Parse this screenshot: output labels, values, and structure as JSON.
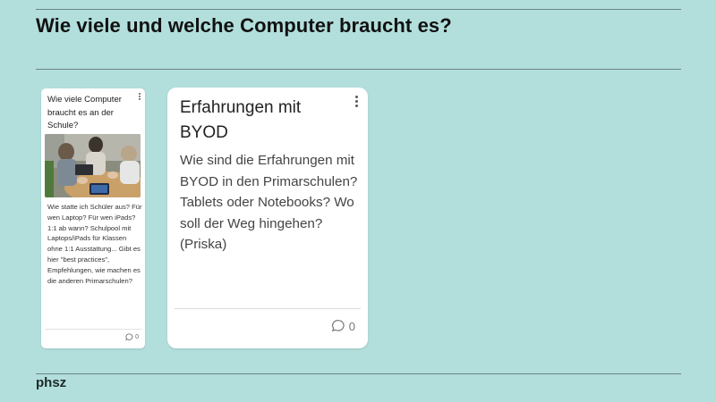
{
  "slide": {
    "title": "Wie viele und welche Computer braucht es?",
    "brand": "phsz"
  },
  "cards": [
    {
      "title": "Wie viele Computer braucht es an der Schule?",
      "body": "Wie statte ich Schüler aus? Für wen Laptop? Für wen iPads? 1:1 ab wann? Schulpool mit Laptops/iPads für Klassen ohne 1:1 Ausstattung... Gibt es hier \"best practices\", Empfehlungen, wie machen es die anderen Primarschulen?",
      "comment_count": "0",
      "image": "classroom-photo"
    },
    {
      "title": "Erfahrungen mit BYOD",
      "body": "Wie sind die Erfahrungen mit BYOD in den Primarschulen? Tablets oder Notebooks? Wo soll der Weg hingehen? (Priska)",
      "comment_count": "0"
    }
  ],
  "icons": {
    "menu": "more-vertical-icon",
    "comments": "comment-icon"
  },
  "colors": {
    "background": "#b2dfdc",
    "card": "#ffffff"
  }
}
